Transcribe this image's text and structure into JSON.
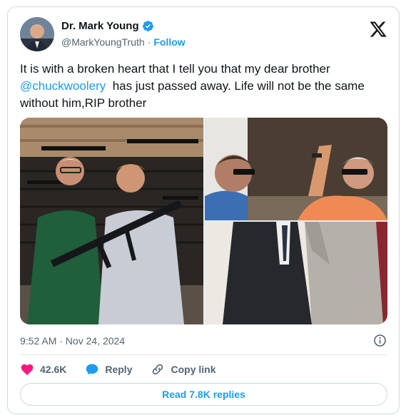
{
  "author": {
    "display_name": "Dr. Mark Young",
    "handle": "@MarkYoungTruth",
    "separator": "·",
    "follow_label": "Follow"
  },
  "tweet": {
    "text_before": "It is with a broken heart that I tell you that my dear brother ",
    "mention": "@chuckwoolery",
    "text_after": "  has just passed away. Life will not be the same without him,RIP brother",
    "timestamp": "9:52 AM · Nov 24, 2024"
  },
  "actions": {
    "like_count": "42.6K",
    "reply_label": "Reply",
    "copy_link_label": "Copy link"
  },
  "read_replies_label": "Read 7.8K replies",
  "colors": {
    "accent": "#1d9bf0",
    "like": "#f91880",
    "text": "#0f1419",
    "muted": "#536471"
  },
  "icons": [
    "verified-badge-icon",
    "x-logo-icon",
    "info-icon",
    "heart-icon",
    "reply-bubble-icon",
    "link-icon"
  ]
}
